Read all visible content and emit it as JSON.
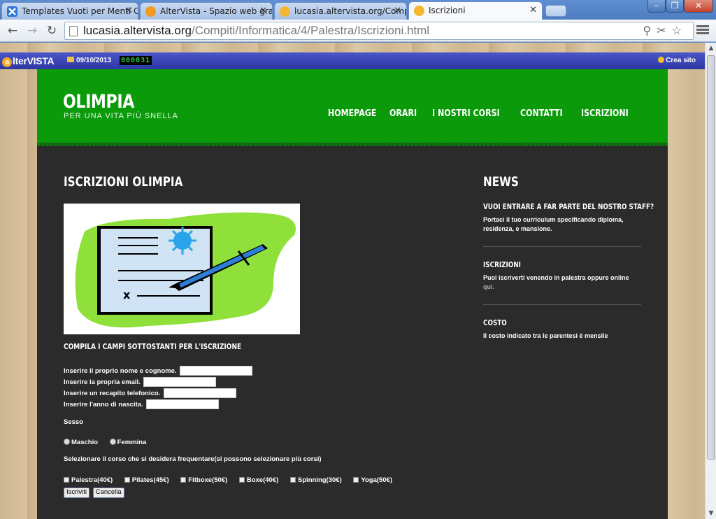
{
  "browser": {
    "tabs": [
      {
        "label": "Templates Vuoti per Menti Cr",
        "favicon": "x-mark-icon"
      },
      {
        "label": "AlterVista - Spazio web gratis",
        "favicon": "altervista-icon"
      },
      {
        "label": "lucasia.altervista.org/Compit",
        "favicon": "altervista-icon"
      },
      {
        "label": "Iscrizioni",
        "favicon": "altervista-icon"
      }
    ],
    "url_host": "lucasia.altervista.org",
    "url_path": "/Compiti/Informatica/4/Palestra/Iscrizioni.html"
  },
  "altervista_bar": {
    "logo": "lterVISTA",
    "logo_mark": "a",
    "date": "09/10/2013",
    "counter": "000031",
    "create_site": "Crea sito"
  },
  "site": {
    "logo": "OLIMPIA",
    "tagline": "PER UNA VITA PIÙ SNELLA",
    "nav": [
      "HOMEPAGE",
      "ORARI",
      "I NOSTRI CORSI",
      "CONTATTI",
      "ISCRIZIONI"
    ]
  },
  "main": {
    "title": "ISCRIZIONI OLIMPIA",
    "form_heading": "COMPILA I CAMPI SOTTOSTANTI PER L'ISCRIZIONE",
    "fields": [
      {
        "label": "Inserire il proprio nome e cognome.",
        "value": ""
      },
      {
        "label": "Inserire la propria email.",
        "value": ""
      },
      {
        "label": "Inserire un recapito telefonico.",
        "value": ""
      },
      {
        "label": "Inserire l'anno di nascita.",
        "value": ""
      }
    ],
    "sex_label": "Sesso",
    "sex_options": [
      "Maschio",
      "Femmina"
    ],
    "course_label": "Selezionare il corso che si desidera frequentare(si possono selezionare più corsi)",
    "courses": [
      "Palestra(40€)",
      "Pilates(45€)",
      "Fitboxe(50€)",
      "Boxe(40€)",
      "Spinning(30€)",
      "Yoga(50€)"
    ],
    "submit": "Iscriviti",
    "reset": "Cancella"
  },
  "sidebar": {
    "title": "NEWS",
    "items": [
      {
        "title": "VUOI ENTRARE A FAR PARTE DEL NOSTRO STAFF?",
        "text": "Portaci il tuo curriculum specificando diploma, residenza, e mansione.",
        "link": ""
      },
      {
        "title": "ISCRIZIONI",
        "text": "Puoi iscriverti venendo in palestra oppure online",
        "link": "qui."
      },
      {
        "title": "COSTO",
        "text": "Il costo indicato tra le parentesi è mensile",
        "link": ""
      }
    ]
  },
  "colors": {
    "header_green": "#0a9a0a",
    "content_bg": "#2b2b2b",
    "altervista_bar": "#3440b5"
  }
}
